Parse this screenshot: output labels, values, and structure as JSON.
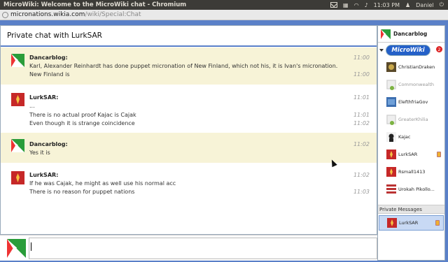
{
  "window": {
    "title": "MicroWiki: Welcome to the MicroWiki chat - Chromium",
    "clock": "11:03 PM",
    "user": "Daniel"
  },
  "address": {
    "host": "micronations.wikia.com",
    "path": "/wiki/Special:Chat"
  },
  "chat": {
    "header": "Private chat with LurkSAR",
    "messages": [
      {
        "author": "Dancarblog:",
        "lines": [
          "Karl, Alexander Reinhardt has done puppet micronation of New Finland, which not his, it is Ivan's micronation.",
          "New Finland is"
        ],
        "times": [
          "11:00",
          "11:00"
        ],
        "highlight": true
      },
      {
        "author": "LurkSAR:",
        "lines": [
          "...",
          "There is no actual proof Kajac is Cajak",
          "Even though it is strange coincidence"
        ],
        "times": [
          "11:01",
          "11:01",
          "11:02"
        ],
        "highlight": false
      },
      {
        "author": "Dancarblog:",
        "lines": [
          "Yes it is"
        ],
        "times": [
          "11:02"
        ],
        "highlight": true
      },
      {
        "author": "LurkSAR:",
        "lines": [
          "If he was Cajak, he might as well use his normal acc",
          "There is no reason for puppet nations"
        ],
        "times": [
          "11:02",
          "11:03"
        ],
        "highlight": false
      }
    ]
  },
  "sidebar": {
    "me": "Dancarblog",
    "wiki_logo": "MicroWiki",
    "wiki_count": "2",
    "users": [
      {
        "name": "ChristianDraken",
        "away": false
      },
      {
        "name": "Commonwealth",
        "away": true
      },
      {
        "name": "ElefthfriaGov",
        "away": false
      },
      {
        "name": "GreaterKhilia",
        "away": true
      },
      {
        "name": "Kajac",
        "away": false
      },
      {
        "name": "LurkSAR",
        "away": false
      },
      {
        "name": "Rsmall1413",
        "away": false
      },
      {
        "name": "Urokah Pikollo...",
        "away": false
      }
    ],
    "pm_header": "Private Messages",
    "pm_user": "LurkSAR"
  },
  "colors": {
    "accent": "#5a80c8",
    "highlight_row": "#f7f3d7",
    "pm_selected": "#c8d9f4"
  }
}
